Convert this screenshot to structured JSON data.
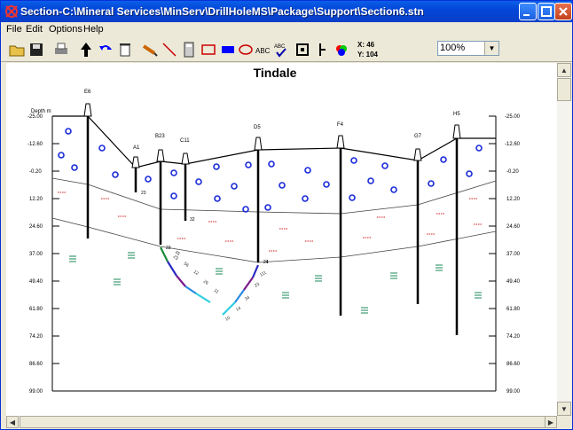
{
  "window": {
    "title": "Section-C:\\Mineral Services\\MinServ\\DrillHoleMS\\Package\\Support\\Section6.stn"
  },
  "menu": [
    "File",
    "Edit",
    "Options",
    "Help"
  ],
  "toolbar": {
    "icons": [
      "open-icon",
      "save-icon",
      "print-icon",
      "pointer-icon",
      "undo-icon",
      "delete-icon",
      "pencil-icon",
      "line-icon",
      "calculator-icon",
      "rectangle-icon",
      "filled-rectangle-icon",
      "ellipse-icon",
      "text-icon",
      "spellcheck-icon",
      "box-icon",
      "tee-icon",
      "color-icon"
    ],
    "x_label": "X:",
    "x_value": "46",
    "y_label": "Y:",
    "y_value": "104",
    "zoom": "100%"
  },
  "section": {
    "title": "Tindale",
    "depth_label": "Depth m",
    "depth_ticks": [
      "-25.00",
      "-12.60",
      "-0.20",
      "12.20",
      "24.60",
      "37.00",
      "49.40",
      "61.80",
      "74.20",
      "86.60",
      "99.00"
    ],
    "holes": [
      "E6",
      "A1",
      "B23",
      "C11",
      "D5",
      "F4",
      "G7",
      "H5"
    ],
    "sample_labels_b": [
      "23",
      "45",
      "56",
      "12",
      "26",
      "11"
    ],
    "sample_labels_d": [
      "21",
      "111",
      "23",
      "34",
      "14",
      "10"
    ],
    "hole_depth_labels": [
      "23",
      "32",
      "23",
      "24"
    ]
  }
}
